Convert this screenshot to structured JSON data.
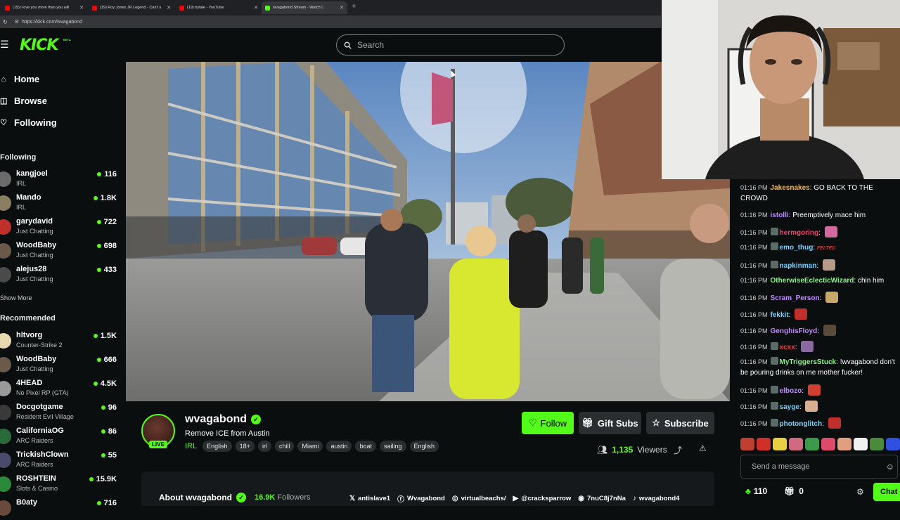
{
  "browser": {
    "tabs": [
      {
        "label": "(19) i love you more than you will"
      },
      {
        "label": "(19) Roy Jones JR Legend - Can't s"
      },
      {
        "label": "(19) hytale - YouTube"
      },
      {
        "label": "wvagabond Stream - Watch L"
      }
    ],
    "url": "https://kick.com/wvagabond"
  },
  "header": {
    "logo": "KICK",
    "beta": "BETA",
    "search_placeholder": "Search"
  },
  "sidebar": {
    "nav": [
      {
        "label": "Home",
        "icon": "home-icon"
      },
      {
        "label": "Browse",
        "icon": "browse-icon"
      },
      {
        "label": "Following",
        "icon": "heart-icon"
      }
    ],
    "following_title": "Following",
    "following": [
      {
        "name": "kangjoel",
        "category": "IRL",
        "viewers": "116",
        "color": "#6b6b6b"
      },
      {
        "name": "Mando",
        "category": "IRL",
        "viewers": "1.8K",
        "color": "#8a7d62"
      },
      {
        "name": "garydavid",
        "category": "Just Chatting",
        "viewers": "722",
        "color": "#c0302a"
      },
      {
        "name": "WoodBaby",
        "category": "Just Chatting",
        "viewers": "698",
        "color": "#6b5a4a"
      },
      {
        "name": "alejus28",
        "category": "Just Chatting",
        "viewers": "433",
        "color": "#4a4a4a"
      }
    ],
    "show_more": "Show More",
    "recommended_title": "Recommended",
    "recommended": [
      {
        "name": "hltvorg",
        "category": "Counter-Strike 2",
        "viewers": "1.5K",
        "color": "#e8d8b0"
      },
      {
        "name": "WoodBaby",
        "category": "Just Chatting",
        "viewers": "666",
        "color": "#6b5a4a"
      },
      {
        "name": "4HEAD",
        "category": "No Pixel RP (GTA)",
        "viewers": "4.5K",
        "color": "#9a9a9a"
      },
      {
        "name": "Docgotgame",
        "category": "Resident Evil Village",
        "viewers": "96",
        "color": "#3a3a3a"
      },
      {
        "name": "CaliforniaOG",
        "category": "ARC Raiders",
        "viewers": "86",
        "color": "#2a6a3a"
      },
      {
        "name": "TrickishClown",
        "category": "ARC Raiders",
        "viewers": "55",
        "color": "#4a4a6a"
      },
      {
        "name": "ROSHTEIN",
        "category": "Slots & Casino",
        "viewers": "15.9K",
        "color": "#2a8a3a"
      },
      {
        "name": "B0aty",
        "category": "",
        "viewers": "716",
        "color": "#6a4a3a"
      }
    ]
  },
  "stream": {
    "channel": "wvagabond",
    "live": "LIVE",
    "title": "Remove ICE from Austin",
    "category": "IRL",
    "tags": [
      "English",
      "18+",
      "irl",
      "chill",
      "Miami",
      "austin",
      "boat",
      "sailing",
      "English"
    ],
    "follow": "Follow",
    "gift_subs": "Gift Subs",
    "subscribe": "Subscribe",
    "viewer_count": "1,135",
    "viewers_label": "Viewers",
    "about": "About wvagabond",
    "followers_count": "16.9K",
    "followers_label": "Followers",
    "socials": [
      {
        "icon": "x-icon",
        "label": "antislave1"
      },
      {
        "icon": "facebook-icon",
        "label": "Wvagabond"
      },
      {
        "icon": "instagram-icon",
        "label": "virtualbeachs/"
      },
      {
        "icon": "youtube-icon",
        "label": "@cracksparrow"
      },
      {
        "icon": "discord-icon",
        "label": "7nuC8j7nNa"
      },
      {
        "icon": "tiktok-icon",
        "label": "wvagabond4"
      }
    ]
  },
  "chat": {
    "messages": [
      {
        "time": "01:16 PM",
        "user": "Jakesnakes",
        "color": "#ffb648",
        "text": "GO BACK TO THE CROWD",
        "badge": false,
        "emote": ""
      },
      {
        "time": "01:16 PM",
        "user": "istolli",
        "color": "#c08cff",
        "text": "Preemptively mace him",
        "badge": false,
        "emote": ""
      },
      {
        "time": "01:16 PM",
        "user": "hermgoring",
        "color": "#ff3a6a",
        "text": "",
        "badge": true,
        "emote": "#d26aa0"
      },
      {
        "time": "01:16 PM",
        "user": "emo_thug",
        "color": "#73d1ff",
        "text": "FELTED",
        "badge": true,
        "emote": ""
      },
      {
        "time": "01:16 PM",
        "user": "napkinman",
        "color": "#73d1ff",
        "text": "",
        "badge": true,
        "emote": "#b89a8a"
      },
      {
        "time": "01:16 PM",
        "user": "OtherwiseEclecticWizard",
        "color": "#7dff7d",
        "text": "chin him",
        "badge": false,
        "emote": ""
      },
      {
        "time": "01:16 PM",
        "user": "Scram_Person",
        "color": "#c08cff",
        "text": "",
        "badge": false,
        "emote": "#c8a86a"
      },
      {
        "time": "01:16 PM",
        "user": "fekkit",
        "color": "#73d1ff",
        "text": "",
        "badge": false,
        "emote": "#c0302a"
      },
      {
        "time": "01:16 PM",
        "user": "GenghisFloyd",
        "color": "#c08cff",
        "text": "",
        "badge": false,
        "emote": "#5a4a3a"
      },
      {
        "time": "01:16 PM",
        "user": "xcxx",
        "color": "#ff3a3a",
        "text": "",
        "badge": true,
        "emote": "#8a6aa0"
      },
      {
        "time": "01:16 PM",
        "user": "MyTriggersStuck",
        "color": "#7dff7d",
        "text": "!wvagabond don't be pouring drinks on me mother fucker!",
        "badge": true,
        "emote": ""
      },
      {
        "time": "01:16 PM",
        "user": "elbozo",
        "color": "#c08cff",
        "text": "",
        "badge": true,
        "emote": "#d04030"
      },
      {
        "time": "01:16 PM",
        "user": "sayge",
        "color": "#73d1ff",
        "text": "",
        "badge": true,
        "emote": "#d8b090"
      },
      {
        "time": "01:16 PM",
        "user": "photonglitch",
        "color": "#73d1ff",
        "text": "",
        "badge": true,
        "emote": "#c0302a"
      }
    ],
    "emote_colors": [
      "#c04030",
      "#d0302a",
      "#e8d040",
      "#d06a80",
      "#3a9a4a",
      "#e04a6a",
      "#e0a080",
      "#f0f0f0",
      "#4a8a3a",
      "#3050e0",
      "#e03030",
      "#d07090"
    ],
    "input_placeholder": "Send a message",
    "points": "110",
    "gift_count": "0",
    "chat_button": "Chat"
  }
}
